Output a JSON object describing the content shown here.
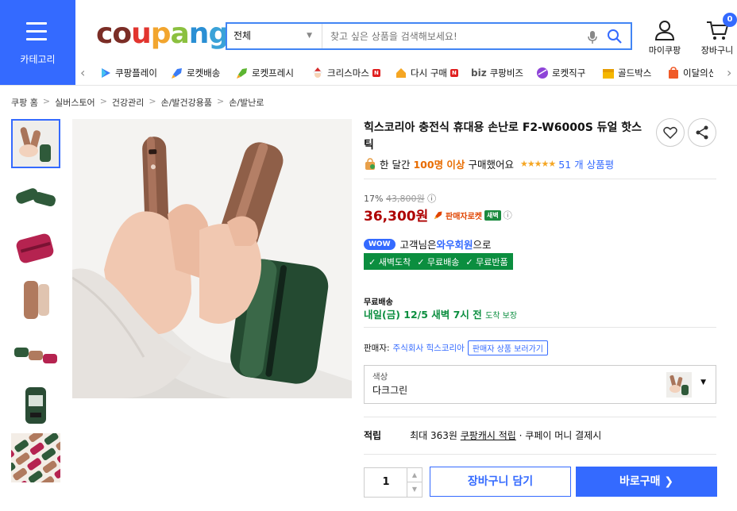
{
  "header": {
    "category_label": "카테고리",
    "logo": [
      "c",
      "o",
      "u",
      "p",
      "a",
      "n",
      "g"
    ],
    "logo_colors": [
      "#7b2d26",
      "#7b2d26",
      "#e2352f",
      "#f2a52e",
      "#8bc03f",
      "#2a8fd4",
      "#3aa2d8"
    ],
    "search": {
      "scope": "전체",
      "placeholder": "찾고 싶은 상품을 검색해보세요!"
    },
    "my_label": "마이쿠팡",
    "cart_label": "장바구니",
    "cart_count": "0"
  },
  "nav": {
    "items": [
      {
        "label": "쿠팡플레이",
        "icon": "play-icon"
      },
      {
        "label": "로켓배송",
        "icon": "rocket-icon"
      },
      {
        "label": "로켓프레시",
        "icon": "rocket-fresh-icon"
      },
      {
        "label": "크리스마스",
        "icon": "santa-icon",
        "badge": "N"
      },
      {
        "label": "다시 구매",
        "icon": "home-icon",
        "badge": "N"
      },
      {
        "label": "쿠팡비즈",
        "icon": "biz-icon",
        "prefix": "biz"
      },
      {
        "label": "로켓직구",
        "icon": "globe-icon"
      },
      {
        "label": "골드박스",
        "icon": "gold-box-icon"
      },
      {
        "label": "이달의신",
        "icon": "new-bag-icon"
      }
    ]
  },
  "breadcrumb": [
    "쿠팡 홈",
    "실버스토어",
    "건강관리",
    "손/발건강용품",
    "손/발난로"
  ],
  "product": {
    "title": "힉스코리아 충전식 휴대용 손난로 F2-W6000S 듀얼 핫스틱",
    "bought_prefix": "한 달간",
    "bought_count": "100명 이상",
    "bought_suffix": "구매했어요",
    "stars": "★★★★★",
    "rating": 4.5,
    "review_count": "51 개 상품평",
    "discount": "17%",
    "original_price": "43,800원",
    "price": "36,300원",
    "rocket_label": "판매자로켓",
    "dawn_label": "새벽",
    "wow_pill": "WOW",
    "wow_text_1": "고객님은",
    "wow_member": "와우회원",
    "wow_text_2": "으로",
    "wow_tags": [
      "✓ 새벽도착",
      "✓ 무료배송",
      "✓ 무료반품"
    ],
    "shipping_title": "무료배송",
    "shipping_date": "내일(금) 12/5 새벽 7시 전",
    "shipping_guarantee": "도착 보장",
    "seller_label": "판매자:",
    "seller_name": "주식회사 힉스코리아",
    "seller_more": "판매자 상품 보러가기",
    "option_label": "색상",
    "option_value": "다크그린",
    "reward_title": "적립",
    "reward_text_1": "최대 363원",
    "reward_link": "쿠팡캐시 적립",
    "reward_text_2": "· 쿠페이 머니 결제시",
    "quantity": "1",
    "add_cart": "장바구니 담기",
    "buy_now": "바로구매 ❯"
  },
  "colors": {
    "accent": "#346aff",
    "price": "#ae0000",
    "green": "#0b8e3f"
  }
}
